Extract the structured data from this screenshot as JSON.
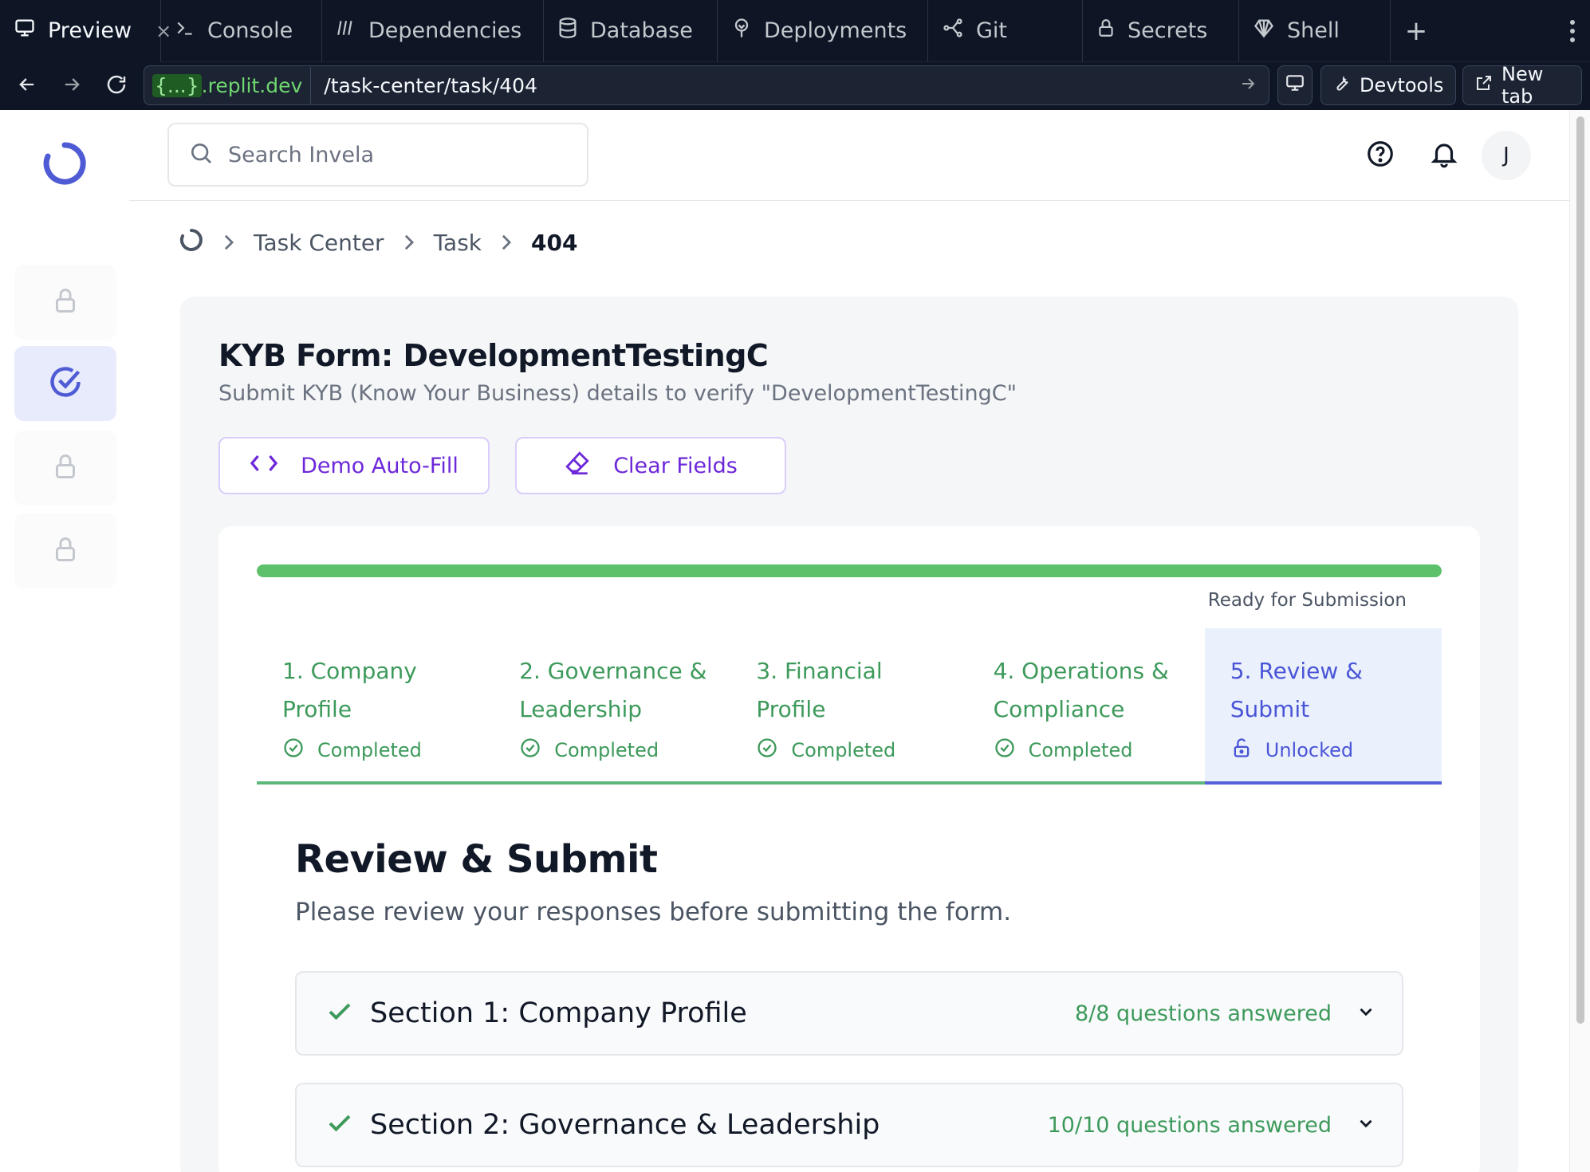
{
  "ide": {
    "tabs": [
      {
        "label": "Preview",
        "icon": "monitor-icon",
        "active": true
      },
      {
        "label": "Console",
        "icon": "terminal-icon"
      },
      {
        "label": "Dependencies",
        "icon": "package-icon"
      },
      {
        "label": "Database",
        "icon": "database-icon"
      },
      {
        "label": "Deployments",
        "icon": "deploy-icon"
      },
      {
        "label": "Git",
        "icon": "git-icon"
      },
      {
        "label": "Secrets",
        "icon": "lock-icon"
      },
      {
        "label": "Shell",
        "icon": "shell-icon"
      }
    ],
    "close_glyph": "×",
    "add_tab": "+",
    "url_host_brace": "{...}",
    "url_host_rest": ".replit.dev",
    "url_path": "/task-center/task/404",
    "devtools_label": "Devtools",
    "new_tab_label": "New tab"
  },
  "header": {
    "search_placeholder": "Search Invela",
    "avatar_initial": "J"
  },
  "breadcrumb": {
    "items": [
      "Task Center",
      "Task"
    ],
    "current": "404"
  },
  "form": {
    "title": "KYB Form: DevelopmentTestingC",
    "subtitle": "Submit KYB (Know Your Business) details to verify \"DevelopmentTestingC\"",
    "demo_button": "Demo Auto-Fill",
    "clear_button": "Clear Fields",
    "progress_percent": 100,
    "progress_status": "Ready for Submission",
    "steps": [
      {
        "title": "1. Company Profile",
        "status": "Completed"
      },
      {
        "title": "2. Governance & Leadership",
        "status": "Completed"
      },
      {
        "title": "3. Financial Profile",
        "status": "Completed"
      },
      {
        "title": "4. Operations & Compliance",
        "status": "Completed"
      },
      {
        "title": "5. Review & Submit",
        "status": "Unlocked"
      }
    ],
    "review": {
      "title": "Review & Submit",
      "subtitle": "Please review your responses before submitting the form.",
      "sections": [
        {
          "title": "Section 1: Company Profile",
          "count": "8/8 questions answered"
        },
        {
          "title": "Section 2: Governance & Leadership",
          "count": "10/10 questions answered"
        }
      ]
    }
  },
  "colors": {
    "ide_bg": "#0e1525",
    "brand": "#4f5bd5",
    "success": "#3d9a5b",
    "accent_purple": "#6d28d9"
  }
}
